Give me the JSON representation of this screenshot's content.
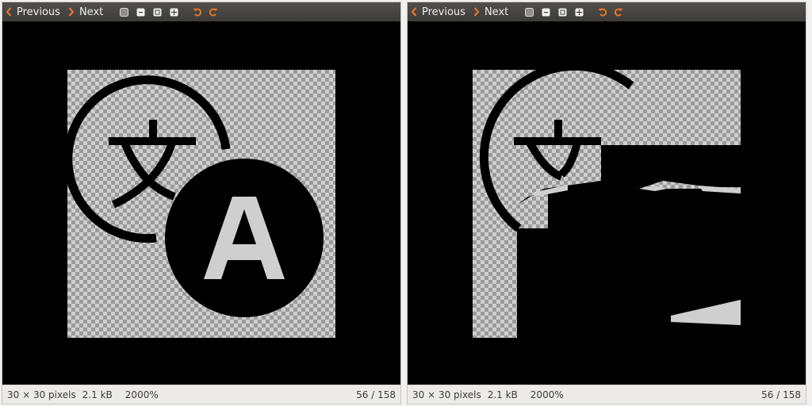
{
  "nav": {
    "previous_label": "Previous",
    "next_label": "Next"
  },
  "toolbar_icons": [
    "zoom-fit-icon",
    "zoom-out-icon",
    "zoom-in-icon",
    "zoom-grid-icon"
  ],
  "rotate_icons": [
    "rotate-left-icon",
    "rotate-right-icon"
  ],
  "status": {
    "dimensions": "30 × 30 pixels",
    "size": "2.1 kB",
    "zoom": "2000%",
    "position": "56 / 158"
  },
  "colors": {
    "accent": "#e6732d",
    "toolbar": "#45443f",
    "viewport": "#000000"
  }
}
